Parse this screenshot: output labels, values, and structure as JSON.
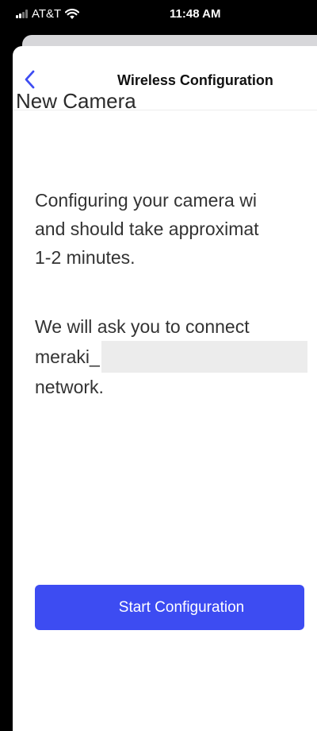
{
  "status_bar": {
    "carrier": "AT&T",
    "time": "11:48 AM",
    "signal_bars_active": 2,
    "icons": [
      "signal-icon",
      "wifi-icon"
    ]
  },
  "nav": {
    "title": "Wireless Configuration",
    "back_icon": "chevron-left-icon"
  },
  "page": {
    "title": "New Camera",
    "paragraph1_lines": [
      "Configuring your camera wi",
      "and should take approximat",
      "1-2 minutes."
    ],
    "paragraph2_line1": "We will ask you to connect",
    "paragraph2_prefix": "meraki_",
    "paragraph2_line3": "network."
  },
  "actions": {
    "start_label": "Start Configuration"
  },
  "colors": {
    "accent": "#3d4cf2",
    "back_chevron": "#3d4cf2",
    "status_bar_bg": "#000000",
    "redaction": "#ececec"
  }
}
